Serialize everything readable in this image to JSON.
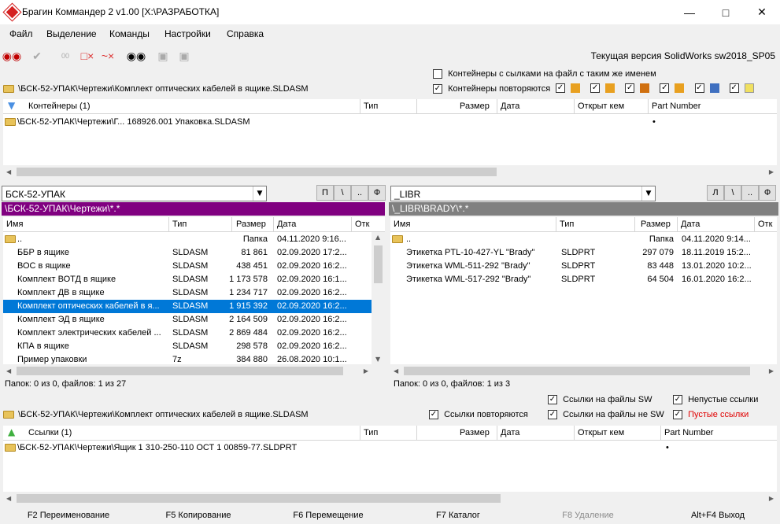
{
  "window": {
    "title": "Брагин Коммандер 2 v1.00  [X:\\РАЗРАБОТКА]",
    "min_icon": "minimize-icon",
    "max_icon": "maximize-icon",
    "close_icon": "close-icon"
  },
  "menu": [
    "Файл",
    "Выделение",
    "Команды",
    "Настройки",
    "Справка"
  ],
  "toolbar": {
    "version_text": "Текущая версия SolidWorks sw2018_SP05"
  },
  "containers": {
    "path": "\\БСК-52-УПАК\\Чертежи\\Комплект оптических кабелей в ящике.SLDASM",
    "option1": "Контейнеры с сылками на файл с таким же именем",
    "option2": "Контейнеры повторяются",
    "option1_checked": false,
    "option2_checked": true,
    "headers": [
      "Контейнеры (1)",
      "Тип",
      "Размер",
      "Дата",
      "Открыт кем",
      "Part Number"
    ],
    "rows": [
      {
        "name": "\\БСК-52-УПАК\\Чертежи\\Г... 168926.001 Упаковка.SLDASM",
        "part": "•"
      }
    ]
  },
  "left_panel": {
    "combo": "БСК-52-УПАК",
    "buttons": [
      "П",
      "\\",
      "..",
      "Ф"
    ],
    "path": "\\БСК-52-УПАК\\Чертежи\\*.*",
    "headers": [
      "Имя",
      "Тип",
      "Размер",
      "Дата",
      "Отк"
    ],
    "rows": [
      {
        "name": "..",
        "type": "",
        "size": "Папка",
        "date": "04.11.2020 9:16..."
      },
      {
        "name": "ББР в ящике",
        "type": "SLDASM",
        "size": "81 861",
        "date": "02.09.2020 17:2..."
      },
      {
        "name": "ВОС в ящике",
        "type": "SLDASM",
        "size": "438 451",
        "date": "02.09.2020 16:2..."
      },
      {
        "name": "Комплект ВОТД в ящике",
        "type": "SLDASM",
        "size": "1 173 578",
        "date": "02.09.2020 16:1..."
      },
      {
        "name": "Комплект ДВ в ящике",
        "type": "SLDASM",
        "size": "1 234 717",
        "date": "02.09.2020 16:2..."
      },
      {
        "name": "Комплект оптических кабелей в я...",
        "type": "SLDASM",
        "size": "1 915 392",
        "date": "02.09.2020 16:2..."
      },
      {
        "name": "Комплект ЭД в ящике",
        "type": "SLDASM",
        "size": "2 164 509",
        "date": "02.09.2020 16:2..."
      },
      {
        "name": "Комплект электрических кабелей ...",
        "type": "SLDASM",
        "size": "2 869 484",
        "date": "02.09.2020 16:2..."
      },
      {
        "name": "КПА в ящике",
        "type": "SLDASM",
        "size": "298 578",
        "date": "02.09.2020 16:2..."
      },
      {
        "name": "Пример упаковки",
        "type": "7z",
        "size": "384 880",
        "date": "26.08.2020 10:1..."
      }
    ],
    "status": "Папок: 0 из 0, файлов: 1 из 27"
  },
  "right_panel": {
    "combo": "_LIBR",
    "buttons": [
      "Л",
      "\\",
      "..",
      "Ф"
    ],
    "path": "\\_LIBR\\BRADY\\*.*",
    "headers": [
      "Имя",
      "Тип",
      "Размер",
      "Дата",
      "Отк"
    ],
    "rows": [
      {
        "name": "..",
        "type": "",
        "size": "Папка",
        "date": "04.11.2020 9:14..."
      },
      {
        "name": "Этикетка PTL-10-427-YL \"Brady\"",
        "type": "SLDPRT",
        "size": "297 079",
        "date": "18.11.2019 15:2..."
      },
      {
        "name": "Этикетка WML-511-292 \"Brady\"",
        "type": "SLDPRT",
        "size": "83 448",
        "date": "13.01.2020 10:2..."
      },
      {
        "name": "Этикетка WML-517-292 \"Brady\"",
        "type": "SLDPRT",
        "size": "64 504",
        "date": "16.01.2020 16:2..."
      }
    ],
    "status": "Папок: 0 из 0, файлов: 1 из 3"
  },
  "links": {
    "path": "\\БСК-52-УПАК\\Чертежи\\Комплект оптических кабелей в ящике.SLDASM",
    "opt_links_sw": "Ссылки на файлы SW",
    "opt_nonempty": "Непустые ссылки",
    "opt_repeat": "Ссылки повторяются",
    "opt_links_not_sw": "Ссылки на файлы не SW",
    "opt_empty": "Пустые ссылки",
    "headers": [
      "Ссылки (1)",
      "Тип",
      "Размер",
      "Дата",
      "Открыт кем",
      "Part Number"
    ],
    "rows": [
      {
        "name": "\\БСК-52-УПАК\\Чертежи\\Ящик 1 310-250-110 ОСТ 1 00859-77.SLDPRT",
        "part": "•"
      }
    ]
  },
  "fkeys": [
    "F2 Переименование",
    "F5 Копирование",
    "F6 Перемещение",
    "F7 Каталог",
    "F8 Удаление",
    "Alt+F4 Выход"
  ],
  "colors": {
    "selection": "#0078d7",
    "left_path_bg": "#800080",
    "right_path_bg": "#808080",
    "empty_links_text": "#e00000",
    "disabled_text": "#8a8a8a"
  }
}
